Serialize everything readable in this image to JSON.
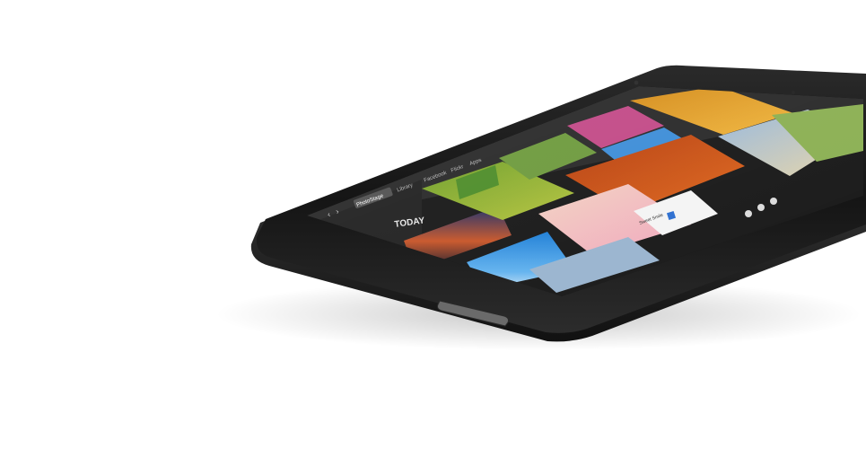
{
  "image": {
    "subject": "tablet-device-photo",
    "background_color": "#ffffff",
    "device_color": "#1b1b1b",
    "bezel_color": "#0d0d0d",
    "rim_color": "#3a3a3a"
  },
  "tablet_ui": {
    "nav": {
      "back_glyph": "‹",
      "forward_glyph": "›",
      "tabs": [
        {
          "label": "PhotoStage",
          "active": true
        },
        {
          "label": "Library",
          "active": false
        },
        {
          "label": "Facebook",
          "active": false
        },
        {
          "label": "Flickr",
          "active": false
        },
        {
          "label": "Apps",
          "active": false
        }
      ]
    },
    "sidebar": {
      "section_label": "TODAY"
    },
    "detail_card": {
      "caption": "Sweet Smile"
    },
    "accent_color": "#2d6fd0"
  }
}
